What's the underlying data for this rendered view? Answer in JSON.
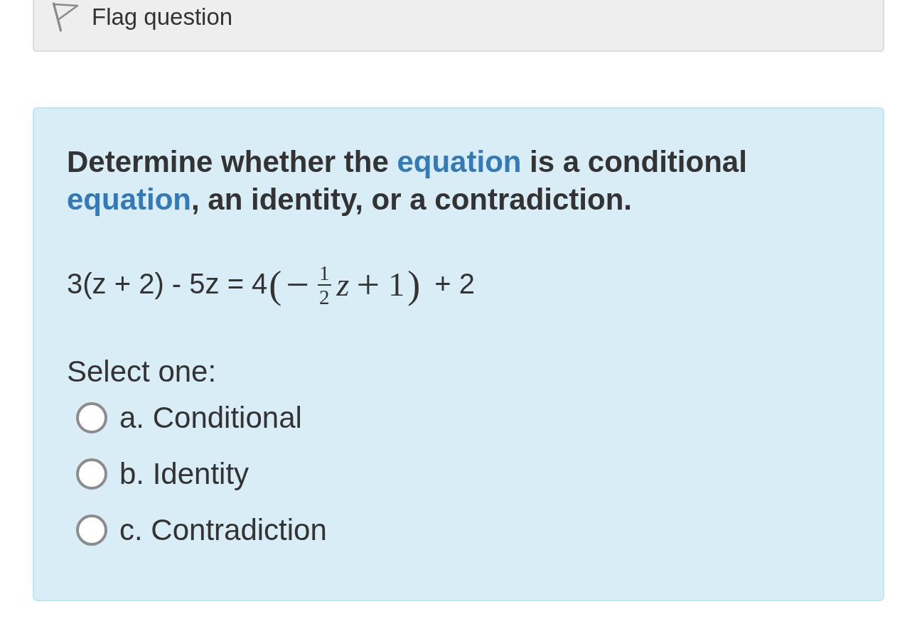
{
  "flag_button": {
    "label": "Flag question"
  },
  "question": {
    "segments": [
      {
        "kind": "text",
        "text": "Determine whether the "
      },
      {
        "kind": "link",
        "text": "equation"
      },
      {
        "kind": "text",
        "text": " is a conditional "
      },
      {
        "kind": "link",
        "text": "equation"
      },
      {
        "kind": "text",
        "text": ", an identity, or a contradiction."
      }
    ]
  },
  "equation": {
    "lead": "3(z + 2) - 5z = 4",
    "math": [
      {
        "kind": "paren",
        "text": "("
      },
      {
        "kind": "sign",
        "text": "−"
      },
      {
        "kind": "fraction",
        "numerator": "1",
        "denominator": "2"
      },
      {
        "kind": "variable",
        "text": "z"
      },
      {
        "kind": "operator",
        "text": "+"
      },
      {
        "kind": "number",
        "text": "1"
      },
      {
        "kind": "paren",
        "text": ")"
      }
    ],
    "tail": "+ 2"
  },
  "prompt": "Select one:",
  "options": [
    {
      "label": "a. Conditional",
      "selected": false
    },
    {
      "label": "b. Identity",
      "selected": false
    },
    {
      "label": "c. Contradiction",
      "selected": false
    }
  ]
}
